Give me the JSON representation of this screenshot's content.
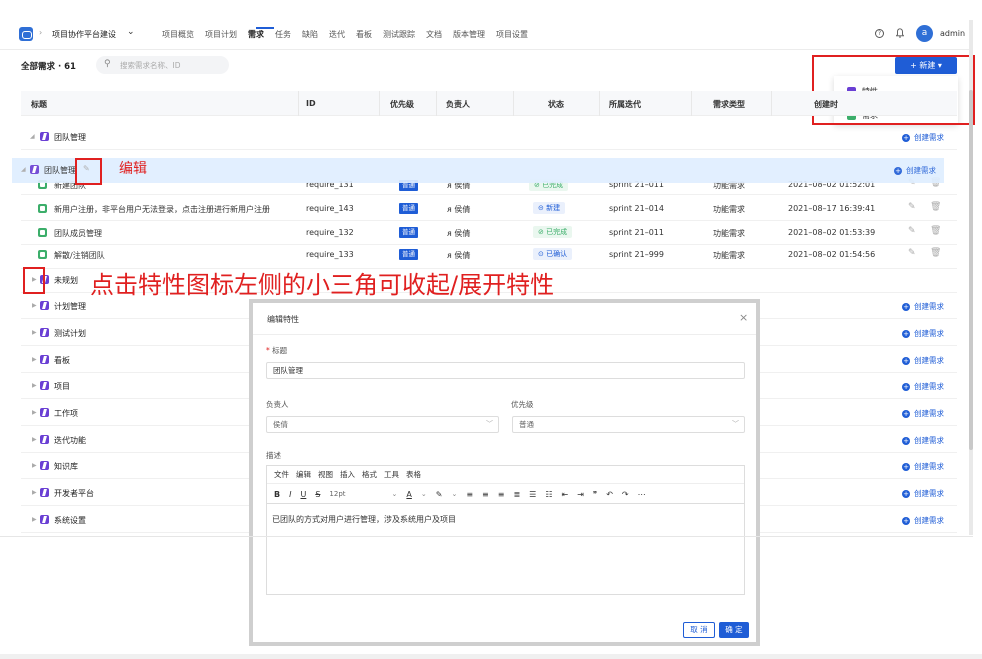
{
  "header": {
    "project_name": "项目协作平台建设",
    "nav": [
      "项目概览",
      "项目计划",
      "需求",
      "任务",
      "缺陷",
      "迭代",
      "看板",
      "测试跟踪",
      "文档",
      "版本管理",
      "项目设置"
    ],
    "active_nav": "需求",
    "username": "admin",
    "avatar_letter": "a"
  },
  "toolbar": {
    "list_title": "全部需求 · 61",
    "search_placeholder": "搜索需求名称、ID",
    "new_button": "+ 新建 ▾",
    "new_menu": [
      "特性",
      "需求"
    ]
  },
  "table": {
    "columns": [
      "标题",
      "ID",
      "优先级",
      "负责人",
      "状态",
      "所属迭代",
      "需求类型",
      "创建时"
    ],
    "expanded_group": "团队管理",
    "rows": [
      {
        "title": "新建团队",
        "id": "require_131",
        "priority": "普通",
        "owner": "侯倩",
        "status": "已完成",
        "sprint": "sprint 21–011",
        "type": "功能需求",
        "created": "2021–08–02 01:52:01"
      },
      {
        "title": "新用户注册，非平台用户无法登录，点击注册进行新用户注册",
        "id": "require_143",
        "priority": "普通",
        "owner": "侯倩",
        "status": "新建",
        "sprint": "sprint 21–014",
        "type": "功能需求",
        "created": "2021–08–17 16:39:41"
      },
      {
        "title": "团队成员管理",
        "id": "require_132",
        "priority": "普通",
        "owner": "侯倩",
        "status": "已完成",
        "sprint": "sprint 21–011",
        "type": "功能需求",
        "created": "2021–08–02 01:53:39"
      },
      {
        "title": "解散/注销团队",
        "id": "require_133",
        "priority": "普通",
        "owner": "侯倩",
        "status": "已确认",
        "sprint": "sprint 21–999",
        "type": "功能需求",
        "created": "2021–08–02 01:54:56"
      }
    ],
    "collapsed_groups": [
      "未规划",
      "计划管理",
      "测试计划",
      "看板",
      "项目",
      "工作项",
      "迭代功能",
      "知识库",
      "开发者平台",
      "系统设置"
    ],
    "create_link": "创建需求"
  },
  "drag_row": {
    "title": "团队管理",
    "create_link": "创建需求"
  },
  "annotations": {
    "edit_note": "编辑",
    "triangle_note": "点击特性图标左侧的小三角可收起/展开特性"
  },
  "modal": {
    "title": "编辑特性",
    "title_label": "标题",
    "title_value": "团队管理",
    "owner_label": "负责人",
    "owner_value": "侯倩",
    "priority_label": "优先级",
    "priority_value": "普通",
    "desc_label": "描述",
    "editor_menu": [
      "文件",
      "编辑",
      "视图",
      "插入",
      "格式",
      "工具",
      "表格"
    ],
    "font_size": "12pt",
    "desc_value": "已团队的方式对用户进行管理，涉及系统用户及项目",
    "cancel": "取 消",
    "ok": "确 定"
  },
  "colors": {
    "primary": "#1f5dd6",
    "feature": "#6a3fd4",
    "requirement": "#3cae6a",
    "annotation": "#e02020"
  }
}
